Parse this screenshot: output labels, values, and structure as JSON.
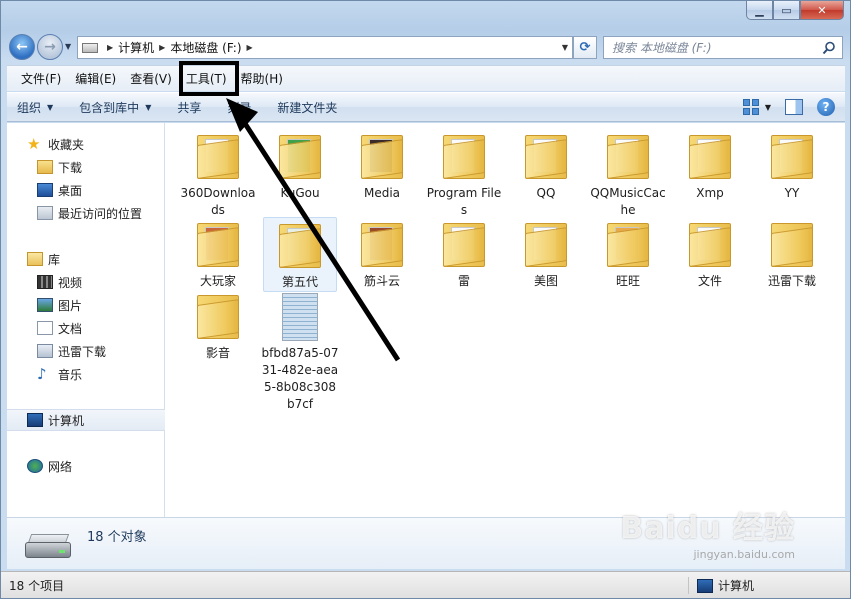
{
  "nav": {
    "address": [
      "计算机",
      "本地磁盘 (F:)"
    ],
    "search_placeholder": "搜索 本地磁盘 (F:)"
  },
  "menu": [
    "文件(F)",
    "编辑(E)",
    "查看(V)",
    "工具(T)",
    "帮助(H)"
  ],
  "commands": [
    {
      "label": "组织",
      "dropdown": true
    },
    {
      "label": "包含到库中",
      "dropdown": true
    },
    {
      "label": "共享",
      "dropdown": false
    },
    {
      "label": "刻录",
      "dropdown": false
    },
    {
      "label": "新建文件夹",
      "dropdown": false
    }
  ],
  "navpane": {
    "favorites": {
      "label": "收藏夹",
      "items": [
        "下载",
        "桌面",
        "最近访问的位置"
      ]
    },
    "libraries": {
      "label": "库",
      "items": [
        "视频",
        "图片",
        "文档",
        "迅雷下载",
        "音乐"
      ]
    },
    "computer": "计算机",
    "network": "网络"
  },
  "files": [
    "360Downloads",
    "KuGou",
    "Media",
    "Program Files",
    "QQ",
    "QQMusicCache",
    "Xmp",
    "YY",
    "大玩家",
    "第五代",
    "筋斗云",
    "雷",
    "美图",
    "旺旺",
    "文件",
    "迅雷下载",
    "影音",
    "bfbd87a5-0731-482e-aea5-8b08c308b7cf"
  ],
  "details": {
    "count_text": "18 个对象"
  },
  "status": {
    "left": "18 个项目",
    "right": "计算机"
  },
  "watermark": {
    "main": "Baidu 经验",
    "sub": "jingyan.baidu.com"
  },
  "colors": {
    "accent": "#1e395b",
    "selection": "#eaf3fc"
  }
}
